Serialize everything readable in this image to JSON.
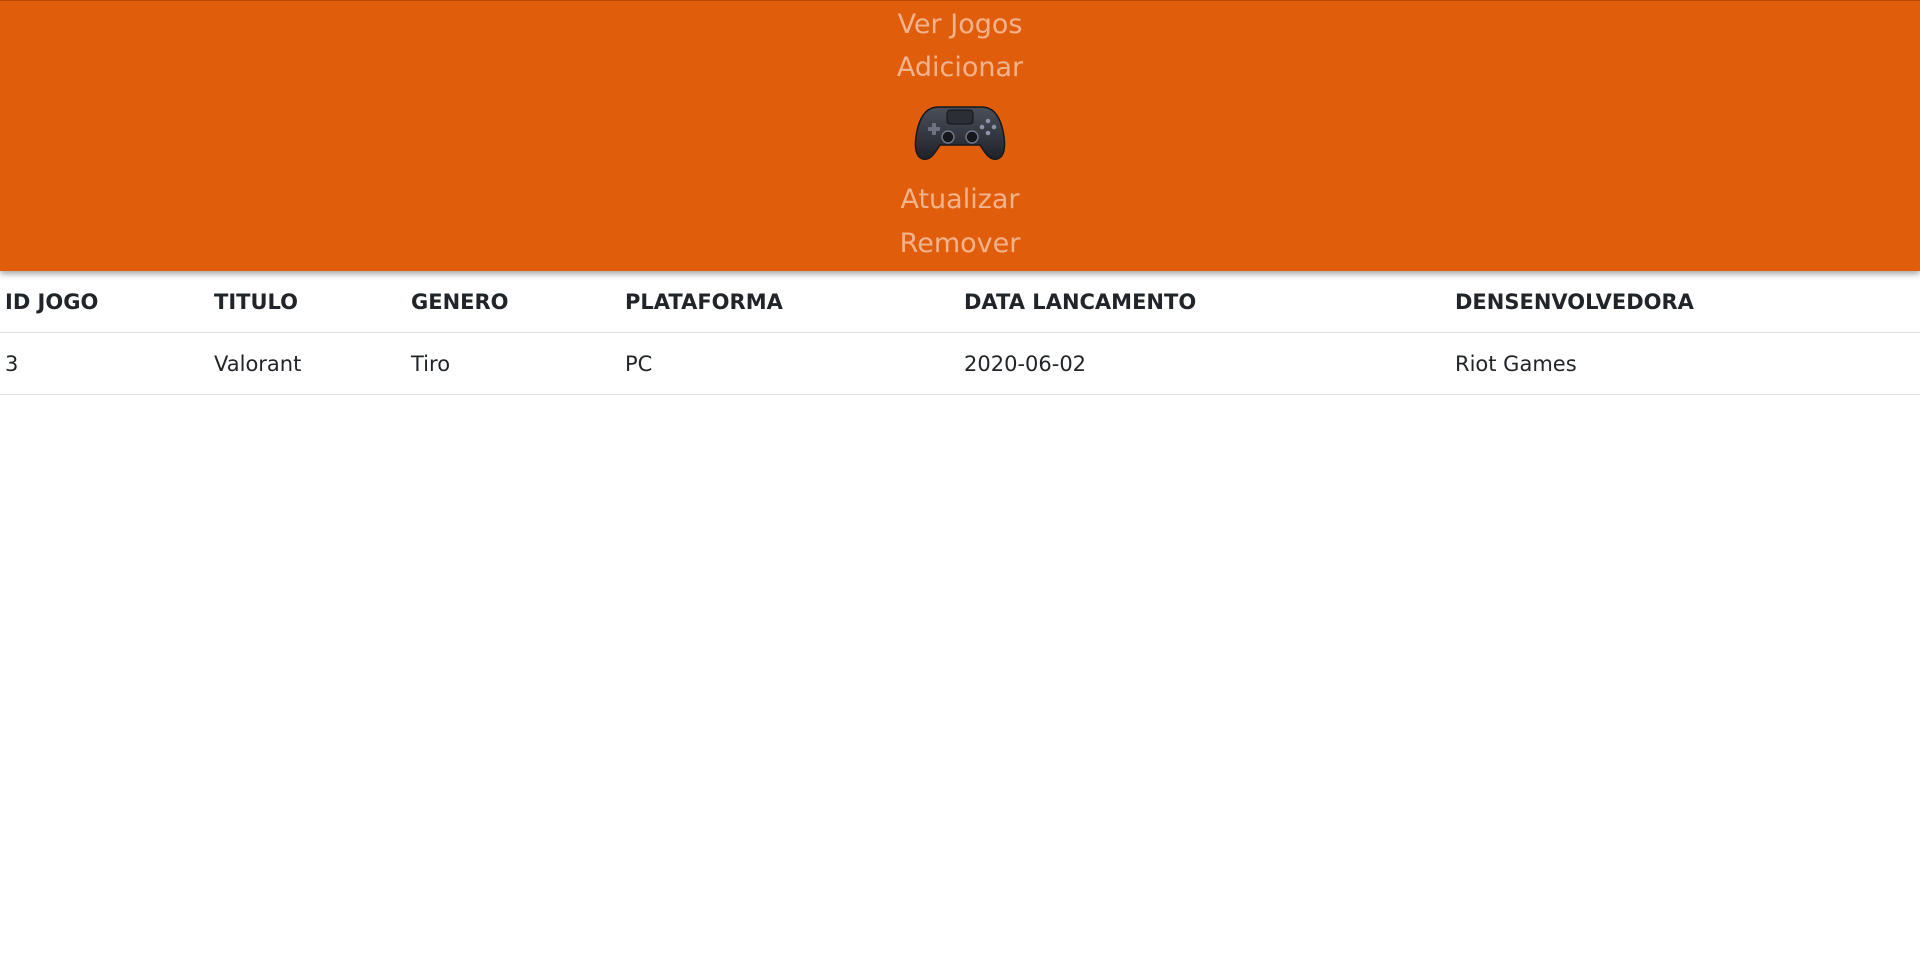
{
  "nav": {
    "links": [
      "Ver Jogos",
      "Adicionar",
      "Atualizar",
      "Remover"
    ],
    "logo_icon": "gamepad-icon",
    "background_color": "#e05d0c",
    "link_color": "#f3b38c"
  },
  "table": {
    "headers": [
      "ID JOGO",
      "TITULO",
      "GENERO",
      "PLATAFORMA",
      "DATA LANCAMENTO",
      "DENSENVOLVEDORA"
    ],
    "rows": [
      [
        "3",
        "Valorant",
        "Tiro",
        "PC",
        "2020-06-02",
        "Riot Games"
      ]
    ]
  }
}
